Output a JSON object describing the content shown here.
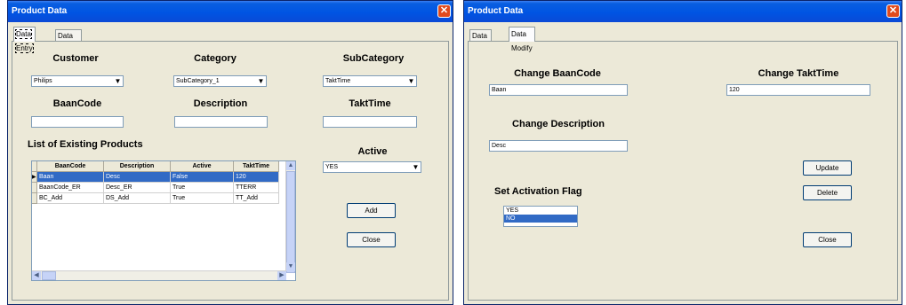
{
  "left_window": {
    "title": "Product Data",
    "tabs": [
      {
        "label": "Data Entry"
      },
      {
        "label": "Data Modify"
      }
    ],
    "customer": {
      "label": "Customer",
      "value": "Philips"
    },
    "category": {
      "label": "Category",
      "value": "SubCategory_1"
    },
    "subcategory": {
      "label": "SubCategory",
      "value": "TaktTime"
    },
    "baancode": {
      "label": "BaanCode",
      "value": ""
    },
    "description": {
      "label": "Description",
      "value": ""
    },
    "takttime": {
      "label": "TaktTime",
      "value": ""
    },
    "list_title": "List of Existing Products",
    "active": {
      "label": "Active",
      "value": "YES"
    },
    "grid": {
      "columns": [
        "BaanCode",
        "Description",
        "Active",
        "TaktTime"
      ],
      "rows": [
        [
          "Baan",
          "Desc",
          "False",
          "120"
        ],
        [
          "BaanCode_ER",
          "Desc_ER",
          "True",
          "TTERR"
        ],
        [
          "BC_Add",
          "DS_Add",
          "True",
          "TT_Add"
        ]
      ],
      "selected_row": 0
    },
    "add_button": "Add",
    "close_button": "Close"
  },
  "right_window": {
    "title": "Product Data",
    "tabs": [
      {
        "label": "Data Entry"
      },
      {
        "label": "Data Modify"
      }
    ],
    "change_baancode": {
      "label": "Change BaanCode",
      "value": "Baan"
    },
    "change_takttime": {
      "label": "Change TaktTime",
      "value": "120"
    },
    "change_description": {
      "label": "Change Description",
      "value": "Desc"
    },
    "activation": {
      "label": "Set Activation Flag",
      "options": [
        "YES",
        "NO"
      ],
      "selected": "NO"
    },
    "update_button": "Update",
    "delete_button": "Delete",
    "close_button": "Close"
  },
  "icons": {
    "close": "close-icon",
    "dropdown": "chevron-down-icon"
  },
  "colors": {
    "titlebar": "#0054e3",
    "selection": "#316ac5",
    "face": "#ece9d8",
    "close": "#e04a1c"
  }
}
